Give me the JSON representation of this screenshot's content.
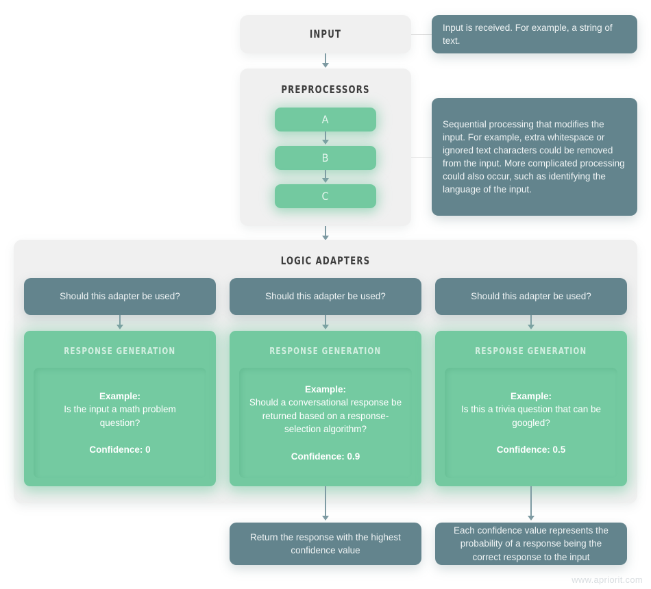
{
  "diagram": {
    "title_input": "INPUT",
    "title_preprocessors": "PREPROCESSORS",
    "title_logic_adapters": "LOGIC ADAPTERS",
    "watermark": "www.apriorit.com"
  },
  "notes": {
    "input_note": "Input is received. For example, a string of text.",
    "preprocessors_note": "Sequential processing that modifies the input. For example, extra whitespace or ignored text characters could be removed from the input. More complicated processing could also occur, such as identifying the language of the input."
  },
  "preprocessors": {
    "steps": [
      {
        "label": "A"
      },
      {
        "label": "B"
      },
      {
        "label": "C"
      }
    ]
  },
  "adapters": [
    {
      "question": "Should this adapter be used?",
      "response_title": "RESPONSE GENERATION",
      "example_label": "Example:",
      "example_text": "Is the input a math problem question?",
      "confidence": "Confidence: 0"
    },
    {
      "question": "Should this adapter be used?",
      "response_title": "RESPONSE GENERATION",
      "example_label": "Example:",
      "example_text": "Should a conversational response be returned based on a response-selection algorithm?",
      "confidence": "Confidence: 0.9"
    },
    {
      "question": "Should this adapter be used?",
      "response_title": "RESPONSE GENERATION",
      "example_label": "Example:",
      "example_text": "Is this a trivia question that can be googled?",
      "confidence": "Confidence: 0.5"
    }
  ],
  "outcomes": {
    "return_box": "Return the response with the highest confidence value",
    "confidence_box": "Each confidence value represents the probability of a response being the correct response to the input"
  },
  "colors": {
    "teal": "#63848d",
    "green": "#73c9a0",
    "panel": "#f0f0f0",
    "background": "#ffffff",
    "arrow": "#7e9ba3",
    "heading_text": "#3d3d3d"
  }
}
